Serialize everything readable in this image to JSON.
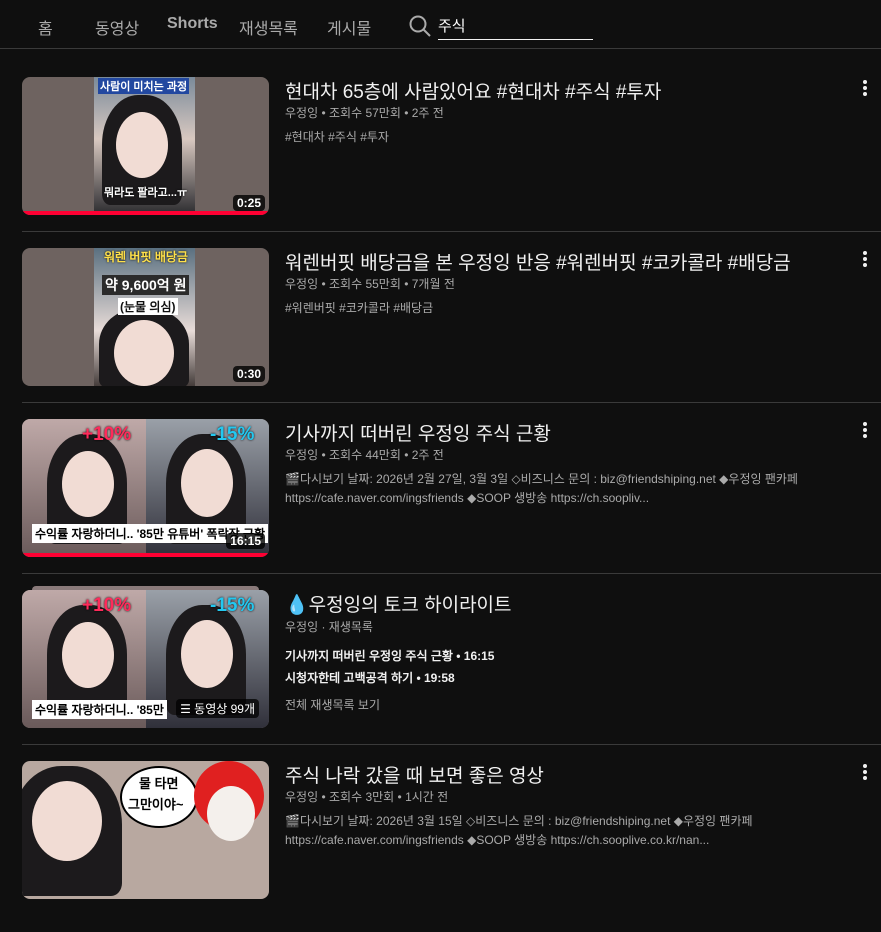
{
  "tabs": [
    "홈",
    "동영상",
    "Shorts",
    "재생목록",
    "게시물"
  ],
  "search": {
    "value": "주식"
  },
  "results": [
    {
      "title": "현대차 65층에 사람있어요 #현대차 #주식 #투자",
      "meta": "우정잉 • 조회수 57만회 • 2주 전",
      "desc": [
        "#현대차 #주식 #투자"
      ],
      "duration": "0:25",
      "overlay": [
        "사람이 미치는 과정",
        "뭐라도 팔라고...ㅠ"
      ]
    },
    {
      "title": "워렌버핏 배당금을 본 우정잉 반응 #워렌버핏 #코카콜라 #배당금",
      "meta": "우정잉 • 조회수 55만회 • 7개월 전",
      "desc": [
        "#워렌버핏 #코카콜라 #배당금"
      ],
      "duration": "0:30",
      "overlay": [
        "워렌 버핏 배당금",
        "약 9,600억 원",
        "(눈물 의심)"
      ]
    },
    {
      "title": "기사까지 떠버린 우정잉 주식 근황",
      "meta": "우정잉 • 조회수 44만회 • 2주 전",
      "desc": [
        "🎬다시보기 날짜: 2026년 2월 27일, 3월 3일 ◇비즈니스 문의 : biz@friendshiping.net ◆우정잉 팬카페",
        "https://cafe.naver.com/ingsfriends ◆SOOP 생방송 https://ch.soopliv..."
      ],
      "duration": "16:15",
      "overlay": [
        "+10%",
        "-15%",
        "수익률 자랑하더니.. '85만 유튜버' 폭락장 근황"
      ]
    },
    {
      "title": "우정잉의 토크 하이라이트",
      "meta": "우정잉 · 재생목록",
      "items": [
        "기사까지 떠버린 우정잉 주식 근황 • 16:15",
        "시청자한테 고백공격 하기 • 19:58"
      ],
      "view_all": "전체 재생목록 보기",
      "count": "동영상 99개",
      "overlay": [
        "+10%",
        "-15%",
        "수익률 자랑하더니.. '85만"
      ]
    },
    {
      "title": "주식 나락 갔을 때 보면 좋은 영상",
      "meta": "우정잉 • 조회수 3만회 • 1시간 전",
      "desc": [
        "🎬다시보기 날짜: 2026년 3월 15일 ◇비즈니스 문의 : biz@friendshiping.net ◆우정잉 팬카페",
        "https://cafe.naver.com/ingsfriends ◆SOOP 생방송 https://ch.sooplive.co.kr/nan..."
      ],
      "overlay": [
        "물 타면",
        "그만이야~"
      ]
    }
  ]
}
